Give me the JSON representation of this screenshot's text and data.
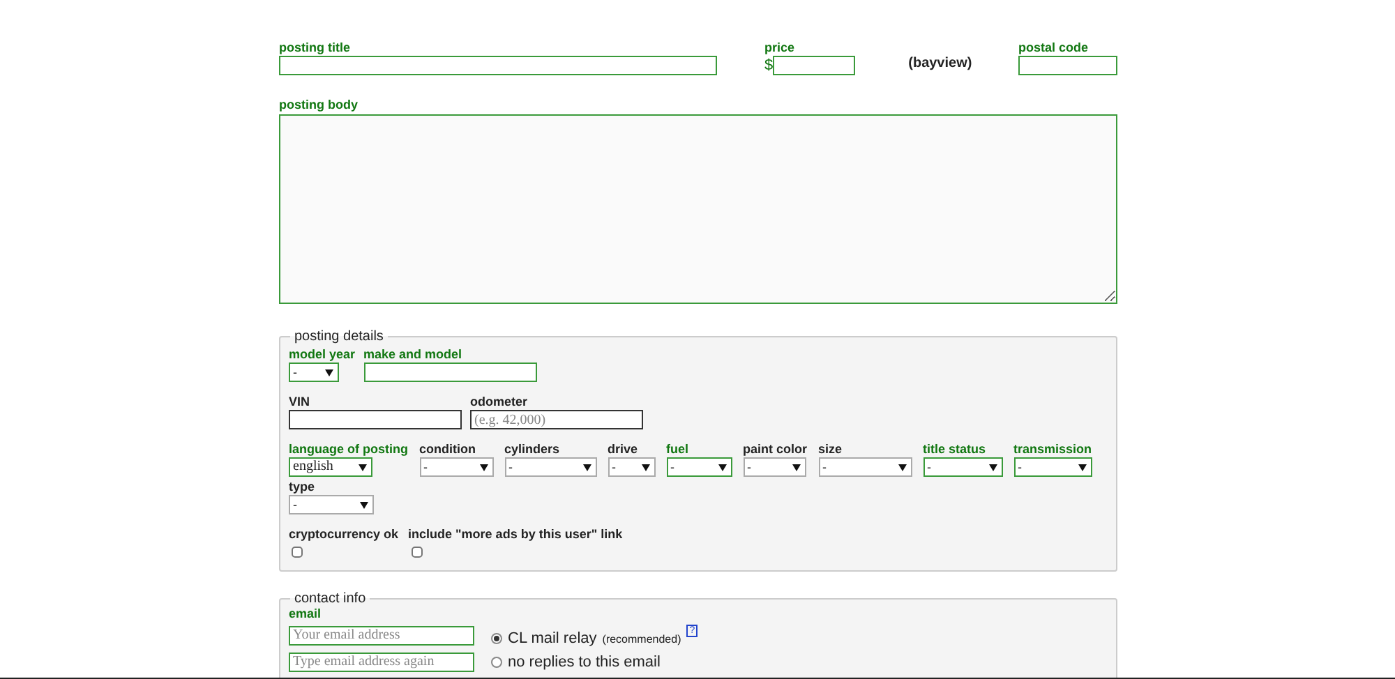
{
  "posting_title": {
    "label": "posting title",
    "required": true
  },
  "price": {
    "label": "price",
    "currency": "$",
    "required": true
  },
  "area": "(bayview)",
  "postal_code": {
    "label": "postal code",
    "required": true
  },
  "posting_body": {
    "label": "posting body",
    "required": true
  },
  "posting_details": {
    "legend": "posting details",
    "field_groups": [
      [
        {
          "kind": "select",
          "label": "model year",
          "value": "-",
          "required": true
        },
        {
          "kind": "text",
          "label": "make and model",
          "required": true
        }
      ],
      [
        {
          "kind": "text",
          "label": "VIN",
          "required": false
        },
        {
          "kind": "text",
          "label": "odometer",
          "placeholder": "(e.g. 42,000)",
          "required": false
        }
      ],
      [
        {
          "kind": "select",
          "label": "language of posting",
          "value": "english",
          "required": true
        },
        {
          "kind": "select",
          "label": "condition",
          "value": "-",
          "required": false
        },
        {
          "kind": "select",
          "label": "cylinders",
          "value": "-",
          "required": false
        },
        {
          "kind": "select",
          "label": "drive",
          "value": "-",
          "required": false
        },
        {
          "kind": "select",
          "label": "fuel",
          "value": "-",
          "required": true
        },
        {
          "kind": "select",
          "label": "paint color",
          "value": "-",
          "required": false
        },
        {
          "kind": "select",
          "label": "size",
          "value": "-",
          "required": false
        },
        {
          "kind": "select",
          "label": "title status",
          "value": "-",
          "required": true
        },
        {
          "kind": "select",
          "label": "transmission",
          "value": "-",
          "required": true
        }
      ],
      [
        {
          "kind": "select",
          "label": "type",
          "value": "-",
          "required": false
        }
      ]
    ],
    "checkboxes": [
      {
        "label": "cryptocurrency ok",
        "checked": false
      },
      {
        "label": "include \"more ads by this user\" link",
        "checked": false
      }
    ]
  },
  "contact_info": {
    "legend": "contact info",
    "email_label": "email",
    "required": true,
    "email_placeholder": "Your email address",
    "confirm_placeholder": "Type email address again",
    "options": [
      {
        "label": "CL mail relay",
        "note": "(recommended)",
        "help": "?",
        "selected": true
      },
      {
        "label": "no replies to this email",
        "selected": false
      }
    ]
  }
}
